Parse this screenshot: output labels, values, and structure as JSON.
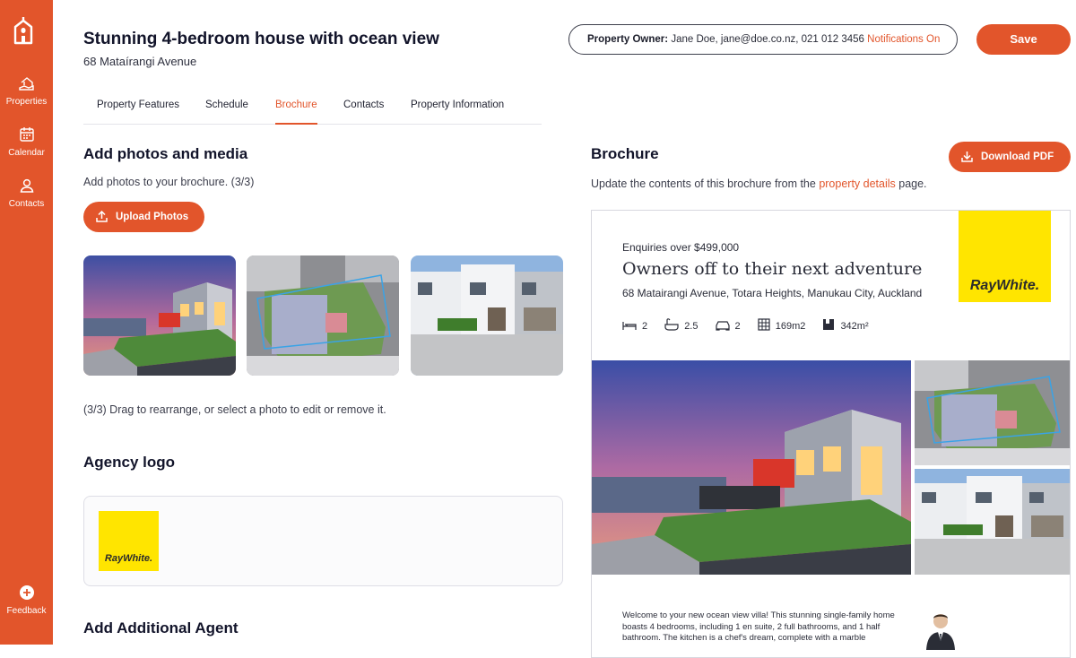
{
  "sidebar": {
    "items": [
      {
        "label": "Properties",
        "icon": "house-hand-icon"
      },
      {
        "label": "Calendar",
        "icon": "calendar-icon"
      },
      {
        "label": "Contacts",
        "icon": "person-icon"
      }
    ],
    "feedback": {
      "label": "Feedback",
      "icon": "plus-circle-icon"
    },
    "logo_icon": "house-logo-icon",
    "color": "#e2552b"
  },
  "header": {
    "title": "Stunning 4-bedroom house with ocean view",
    "address": "68 Mataírangi Avenue",
    "owner_label": "Property Owner:",
    "owner_value": "Jane Doe, jane@doe.co.nz, 021 012 3456",
    "notifications": "Notifications On",
    "save_label": "Save"
  },
  "tabs": [
    "Property Features",
    "Schedule",
    "Brochure",
    "Contacts",
    "Property Information"
  ],
  "active_tab": "Brochure",
  "left": {
    "photos_heading": "Add photos and media",
    "photos_hint": "Add photos to your brochure. (3/3)",
    "upload_label": "Upload Photos",
    "drag_hint": "(3/3) Drag to rearrange, or select a photo to edit or remove it.",
    "agency_heading": "Agency logo",
    "agency_logo_text": "RayWhite.",
    "additional_heading": "Add Additional Agent"
  },
  "right": {
    "heading": "Brochure",
    "download_label": "Download PDF",
    "desc_before": "Update the contents of this brochure from the ",
    "desc_link": "property details",
    "desc_after": " page.",
    "brochure": {
      "enquiries": "Enquiries over $499,000",
      "headline": "Owners off to their next adventure",
      "address": "68 Matairangi Avenue, Totara Heights, Manukau City, Auckland",
      "logo_text": "RayWhite.",
      "features": {
        "bedrooms": "2",
        "bathrooms": "2.5",
        "garage": "2",
        "floor_area": "169m2",
        "land_area": "342m²"
      },
      "description": "Welcome to your new ocean view villa! This stunning single-family home boasts 4 bedrooms, including 1 en suite, 2 full bathrooms, and 1 half bathroom. The kitchen is a chef's dream, complete with a marble"
    }
  },
  "colors": {
    "accent": "#e2552b",
    "logo_yellow": "#ffe500",
    "text_dark": "#12142a"
  }
}
